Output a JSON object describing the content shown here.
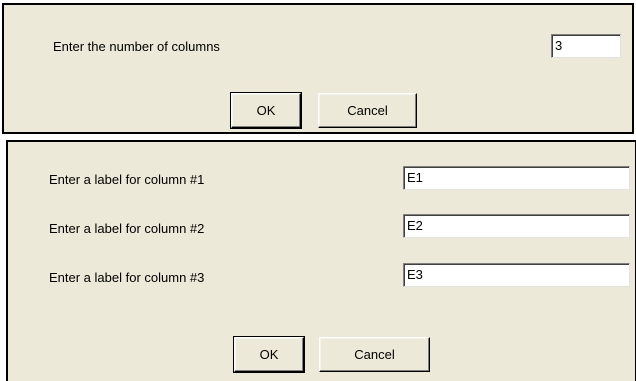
{
  "columns_dialog": {
    "prompt": "Enter the number of columns",
    "value": "3",
    "ok_label": "OK",
    "cancel_label": "Cancel"
  },
  "labels_dialog": {
    "rows": [
      {
        "prompt": "Enter a label for column #1",
        "value": "E1"
      },
      {
        "prompt": "Enter a label for column #2",
        "value": "E2"
      },
      {
        "prompt": "Enter a label for column #3",
        "value": "E3"
      }
    ],
    "ok_label": "OK",
    "cancel_label": "Cancel"
  }
}
